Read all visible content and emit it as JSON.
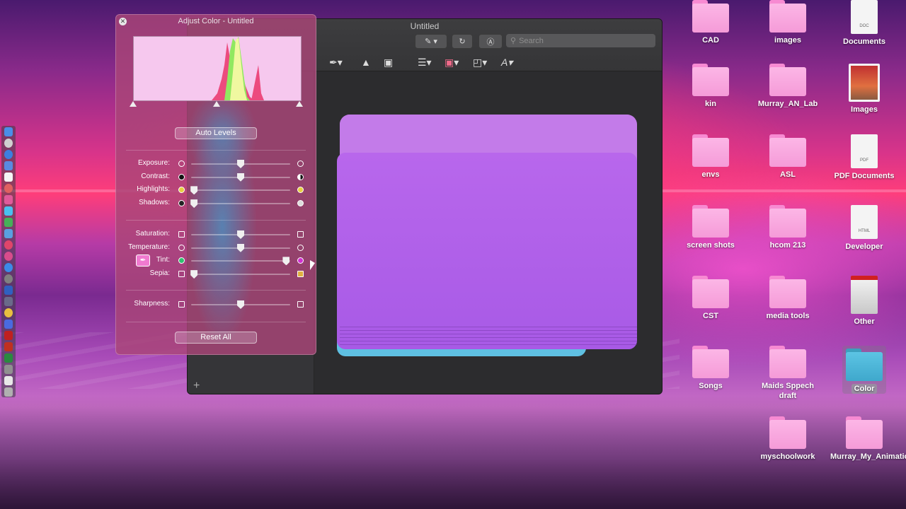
{
  "preview_window": {
    "title": "Untitled",
    "search_placeholder": "Search",
    "add_label": "+"
  },
  "adjust_panel": {
    "title": "Adjust Color - Untitled",
    "auto_levels_label": "Auto Levels",
    "reset_all_label": "Reset All",
    "sliders_group1": [
      {
        "label": "Exposure:",
        "value": 0.5,
        "left_icon": "exposure-low-icon",
        "right_icon": "exposure-high-icon"
      },
      {
        "label": "Contrast:",
        "value": 0.5,
        "left_icon": "contrast-low-icon",
        "right_icon": "contrast-high-icon"
      },
      {
        "label": "Highlights:",
        "value": 0.03,
        "left_icon": "highlights-low-icon",
        "right_icon": "highlights-high-icon"
      },
      {
        "label": "Shadows:",
        "value": 0.03,
        "left_icon": "shadows-low-icon",
        "right_icon": "shadows-high-icon"
      }
    ],
    "sliders_group2": [
      {
        "label": "Saturation:",
        "value": 0.5,
        "left_icon": "saturation-low-icon",
        "right_icon": "saturation-high-icon"
      },
      {
        "label": "Temperature:",
        "value": 0.5,
        "left_icon": "temperature-cool-icon",
        "right_icon": "temperature-warm-icon"
      },
      {
        "label": "Tint:",
        "value": 0.96,
        "left_icon": "tint-green-icon",
        "right_icon": "tint-magenta-icon"
      },
      {
        "label": "Sepia:",
        "value": 0.03,
        "left_icon": "sepia-low-icon",
        "right_icon": "sepia-high-icon"
      }
    ],
    "sliders_group3": [
      {
        "label": "Sharpness:",
        "value": 0.5,
        "left_icon": "sharpness-low-icon",
        "right_icon": "sharpness-high-icon"
      }
    ]
  },
  "desktop_icons": [
    {
      "label": "CAD",
      "kind": "folder"
    },
    {
      "label": "images",
      "kind": "folder"
    },
    {
      "label": "Documents",
      "kind": "doc",
      "badge": "DOC"
    },
    {
      "label": "kin",
      "kind": "folder"
    },
    {
      "label": "Murray_AN_Lab",
      "kind": "folder"
    },
    {
      "label": "Images",
      "kind": "photo"
    },
    {
      "label": "envs",
      "kind": "folder"
    },
    {
      "label": "ASL",
      "kind": "folder"
    },
    {
      "label": "PDF Documents",
      "kind": "doc",
      "badge": "PDF"
    },
    {
      "label": "screen shots",
      "kind": "folder"
    },
    {
      "label": "hcom 213",
      "kind": "folder"
    },
    {
      "label": "Developer",
      "kind": "doc",
      "badge": "HTML"
    },
    {
      "label": "CST",
      "kind": "folder"
    },
    {
      "label": "media tools",
      "kind": "folder"
    },
    {
      "label": "Other",
      "kind": "drive"
    },
    {
      "label": "Songs",
      "kind": "folder"
    },
    {
      "label": "Maids Sppech draft",
      "kind": "folder"
    },
    {
      "label": "Color",
      "kind": "folder-teal"
    },
    {
      "label": "myschoolwork",
      "kind": "folder"
    },
    {
      "label": "Murray_My_Animation",
      "kind": "folder"
    }
  ],
  "colors": {
    "desktop_folder": "#f59bd8",
    "big_folder": "#b867ec",
    "accent_teal": "#5fc0e2"
  }
}
